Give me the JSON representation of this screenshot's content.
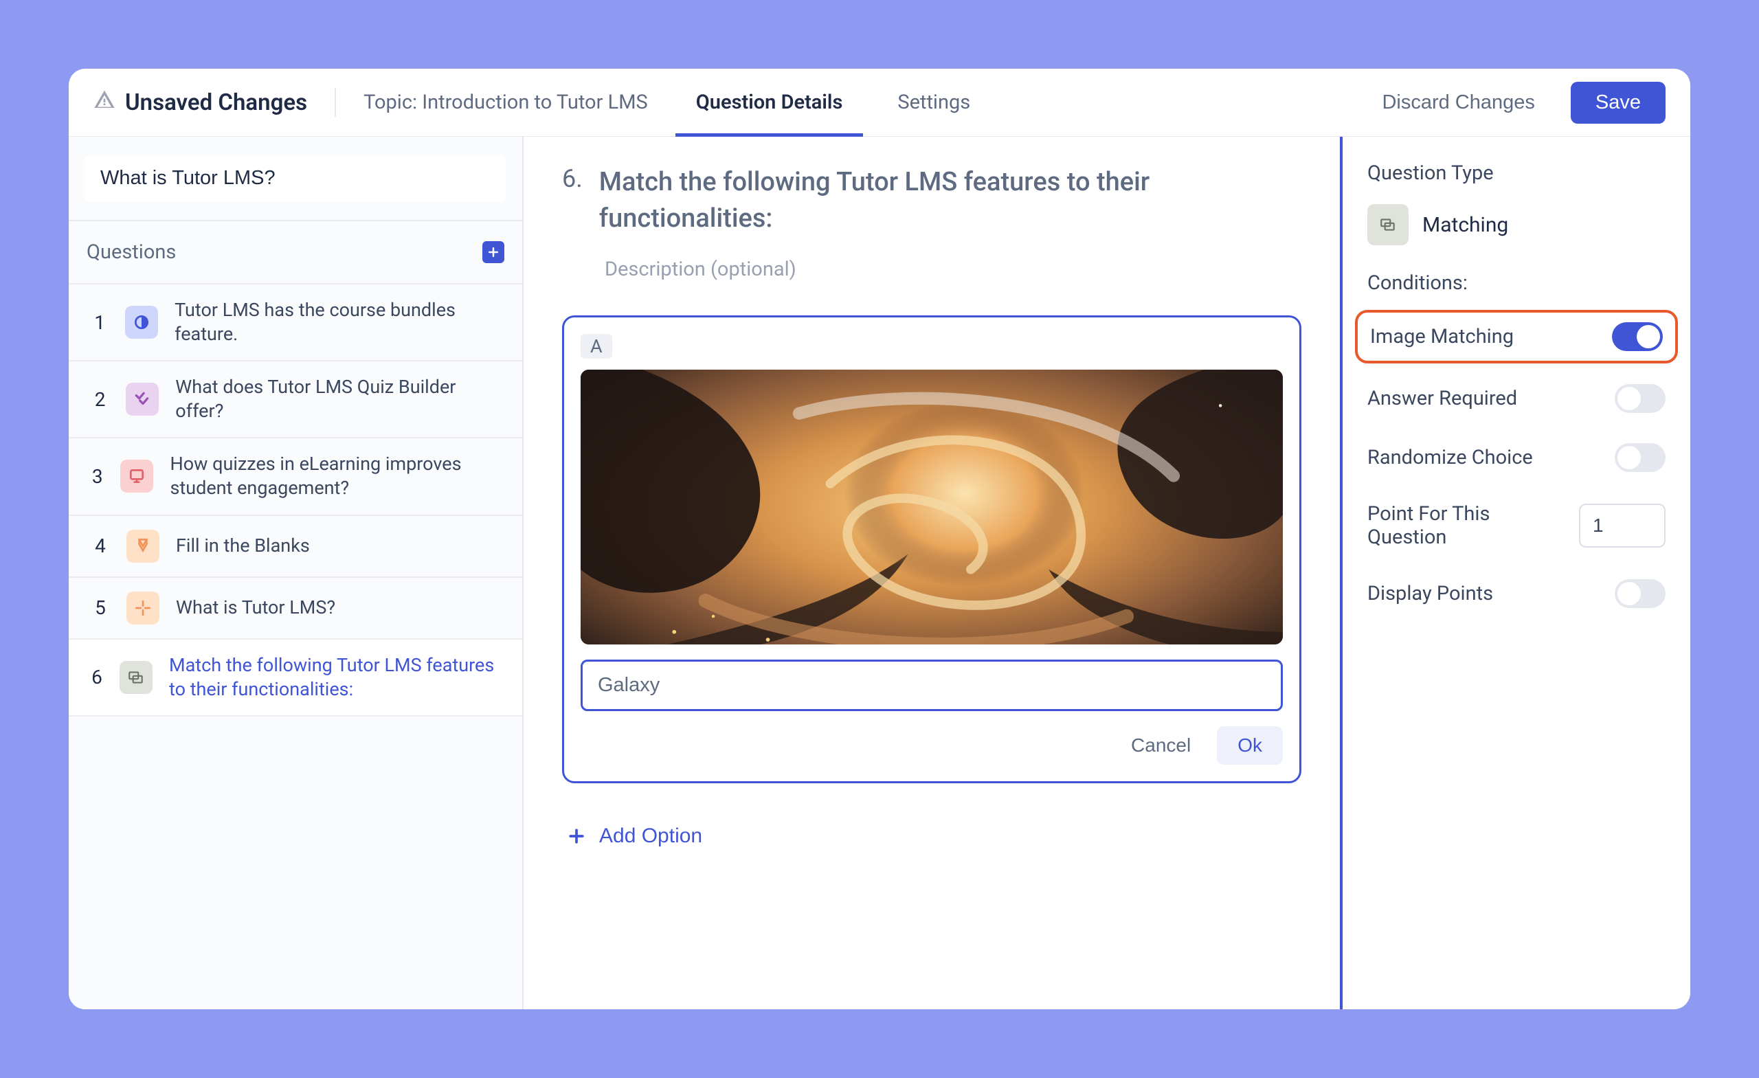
{
  "header": {
    "unsaved_label": "Unsaved Changes",
    "topic": "Topic: Introduction to Tutor LMS",
    "tabs": {
      "details": "Question Details",
      "settings": "Settings"
    },
    "discard": "Discard Changes",
    "save": "Save"
  },
  "sidebar": {
    "search_value": "What is Tutor LMS?",
    "questions_heading": "Questions",
    "items": [
      {
        "num": "1",
        "text": "Tutor LMS has the course bundles feature.",
        "icon": "truefalse",
        "bg": "#cfd6fb",
        "fg": "#4054d6"
      },
      {
        "num": "2",
        "text": "What does Tutor LMS Quiz Builder offer?",
        "icon": "multichoice",
        "bg": "#ead3f1",
        "fg": "#9a52b6"
      },
      {
        "num": "3",
        "text": "How quizzes in eLearning improves student engagement?",
        "icon": "openended",
        "bg": "#fbd0d0",
        "fg": "#e0636c"
      },
      {
        "num": "4",
        "text": "Fill in the Blanks",
        "icon": "fillblank",
        "bg": "#ffe1c7",
        "fg": "#f1945a"
      },
      {
        "num": "5",
        "text": "What is Tutor LMS?",
        "icon": "shortanswer",
        "bg": "#ffe1c7",
        "fg": "#f1945a"
      },
      {
        "num": "6",
        "text": "Match the following Tutor LMS features to their functionalities:",
        "icon": "matching",
        "bg": "#dfe3db",
        "fg": "#6b7269",
        "active": true
      }
    ]
  },
  "main": {
    "number": "6.",
    "title": "Match the following Tutor LMS features to their functionalities:",
    "description_placeholder": "Description (optional)",
    "option": {
      "letter": "A",
      "value": "Galaxy",
      "cancel": "Cancel",
      "ok": "Ok"
    },
    "add_option": "Add Option"
  },
  "right": {
    "question_type_label": "Question Type",
    "question_type_value": "Matching",
    "conditions_label": "Conditions:",
    "conditions": {
      "image_matching": {
        "label": "Image Matching",
        "on": true
      },
      "answer_required": {
        "label": "Answer Required",
        "on": false
      },
      "randomize_choice": {
        "label": "Randomize Choice",
        "on": false
      },
      "points_label": "Point For This Question",
      "points_value": "1",
      "display_points": {
        "label": "Display Points",
        "on": false
      }
    }
  }
}
